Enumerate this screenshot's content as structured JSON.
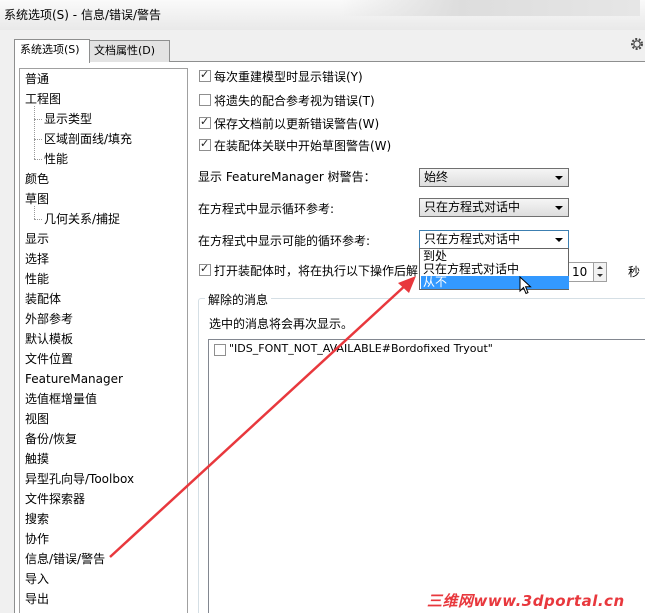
{
  "window": {
    "title": "系统选项(S) - 信息/错误/警告"
  },
  "tabs": [
    {
      "label": "系统选项(S)",
      "active": true
    },
    {
      "label": "文档属性(D)",
      "active": false
    }
  ],
  "tree": {
    "items": [
      {
        "label": "普通",
        "level": 0
      },
      {
        "label": "工程图",
        "level": 0
      },
      {
        "label": "显示类型",
        "level": 1
      },
      {
        "label": "区域剖面线/填充",
        "level": 1
      },
      {
        "label": "性能",
        "level": 1
      },
      {
        "label": "颜色",
        "level": 0
      },
      {
        "label": "草图",
        "level": 0
      },
      {
        "label": "几何关系/捕捉",
        "level": 1
      },
      {
        "label": "显示",
        "level": 0
      },
      {
        "label": "选择",
        "level": 0
      },
      {
        "label": "性能",
        "level": 0
      },
      {
        "label": "装配体",
        "level": 0
      },
      {
        "label": "外部参考",
        "level": 0
      },
      {
        "label": "默认模板",
        "level": 0
      },
      {
        "label": "文件位置",
        "level": 0
      },
      {
        "label": "FeatureManager",
        "level": 0
      },
      {
        "label": "选值框增量值",
        "level": 0
      },
      {
        "label": "视图",
        "level": 0
      },
      {
        "label": "备份/恢复",
        "level": 0
      },
      {
        "label": "触摸",
        "level": 0
      },
      {
        "label": "异型孔向导/Toolbox",
        "level": 0
      },
      {
        "label": "文件探索器",
        "level": 0
      },
      {
        "label": "搜索",
        "level": 0
      },
      {
        "label": "协作",
        "level": 0
      },
      {
        "label": "信息/错误/警告",
        "level": 0
      },
      {
        "label": "导入",
        "level": 0
      },
      {
        "label": "导出",
        "level": 0
      }
    ]
  },
  "options": {
    "checkboxes": [
      {
        "label": "每次重建模型时显示错误(Y)",
        "checked": true
      },
      {
        "label": "将遗失的配合参考视为错误(T)",
        "checked": false
      },
      {
        "label": "保存文档前以更新错误警告(W)",
        "checked": true
      },
      {
        "label": "在装配体关联中开始草图警告(W)",
        "checked": true
      }
    ],
    "fm_warning": {
      "label": "显示 FeatureManager 树警告：",
      "value": "始终"
    },
    "loop_ref": {
      "label": "在方程式中显示循环参考:",
      "value": "只在方程式对话中"
    },
    "possible_loop_ref": {
      "label": "在方程式中显示可能的循环参考:",
      "value": "只在方程式对话中"
    },
    "dropdown_options": [
      "到处",
      "只在方程式对话中",
      "从不"
    ],
    "dropdown_selected": "从不",
    "assembly_open": {
      "label": "打开装配体时，将在执行以下操作后解",
      "checked": true,
      "value": "10",
      "unit": "秒"
    }
  },
  "dismissed": {
    "title": "解除的消息",
    "hint": "选中的消息将会再次显示。",
    "messages": [
      {
        "label": "\"IDS_FONT_NOT_AVAILABLE#Bordofixed Tryout\"",
        "checked": false
      }
    ]
  },
  "watermark": "三维网www.3dportal.cn",
  "colors": {
    "accent": "#3399ff",
    "annotation_arrow": "#e8383d"
  }
}
